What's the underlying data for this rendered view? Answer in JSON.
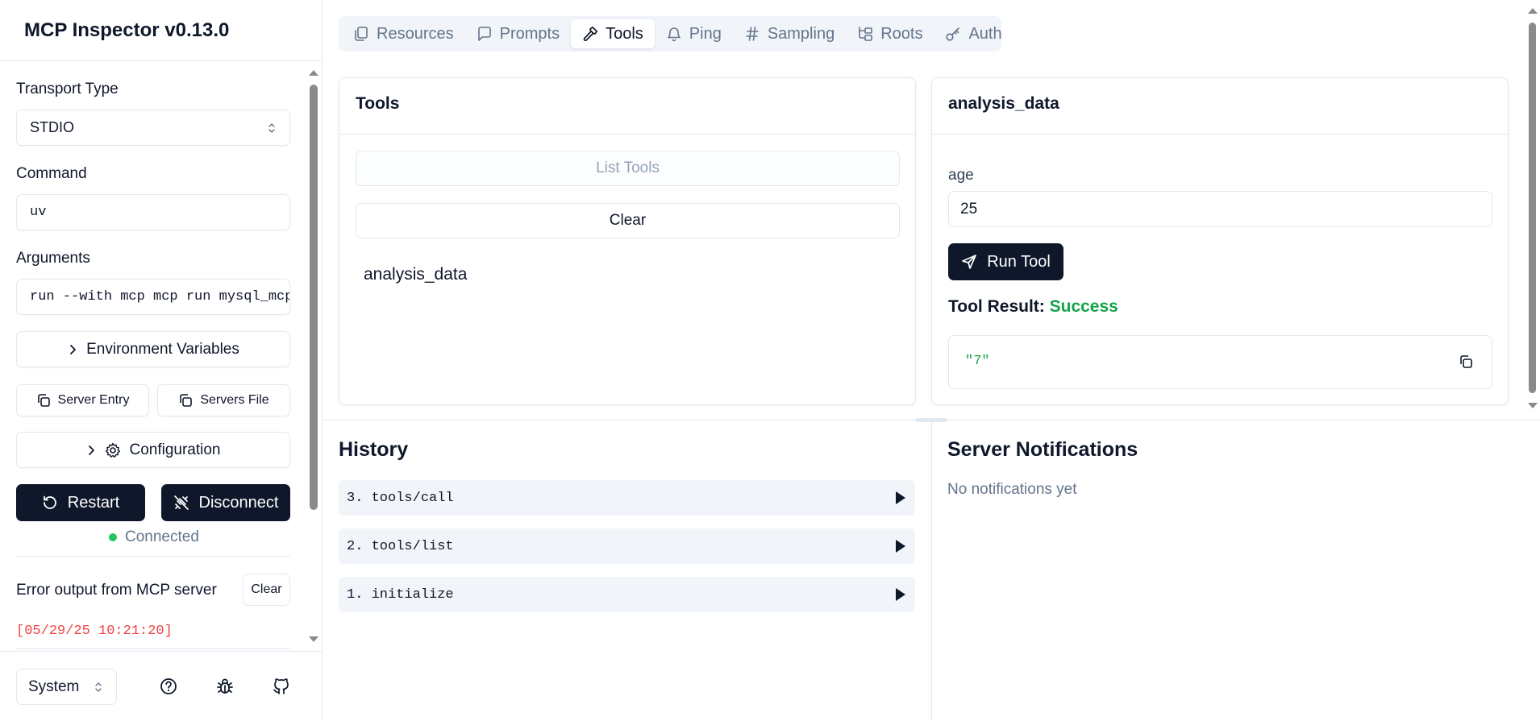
{
  "app": {
    "title": "MCP Inspector v0.13.0"
  },
  "sidebar": {
    "transport_label": "Transport Type",
    "transport_value": "STDIO",
    "command_label": "Command",
    "command_value": "uv",
    "arguments_label": "Arguments",
    "arguments_value": "run --with mcp mcp run mysql_mcp",
    "env_vars_label": "Environment Variables",
    "server_entry_label": "Server Entry",
    "servers_file_label": "Servers File",
    "configuration_label": "Configuration",
    "restart_label": "Restart",
    "disconnect_label": "Disconnect",
    "status_text": "Connected",
    "status_color": "#22c55e",
    "error_label": "Error output from MCP server",
    "error_clear_label": "Clear",
    "error_lines": [
      "[05/29/25 10:21:20]"
    ],
    "theme_value": "System"
  },
  "tabs": [
    {
      "label": "Resources",
      "icon": "files-icon"
    },
    {
      "label": "Prompts",
      "icon": "message-square-icon"
    },
    {
      "label": "Tools",
      "icon": "hammer-icon",
      "active": true
    },
    {
      "label": "Ping",
      "icon": "bell-icon"
    },
    {
      "label": "Sampling",
      "icon": "hash-icon"
    },
    {
      "label": "Roots",
      "icon": "folder-tree-icon"
    },
    {
      "label": "Auth",
      "icon": "key-icon"
    }
  ],
  "tools_panel": {
    "title": "Tools",
    "list_tools_label": "List Tools",
    "clear_label": "Clear",
    "items": [
      "analysis_data"
    ]
  },
  "tool_detail": {
    "title": "analysis_data",
    "param_label": "age",
    "param_value": "25",
    "run_label": "Run Tool",
    "result_label": "Tool Result:",
    "result_status": "Success",
    "result_status_color": "#16a34a",
    "result_value": "\"7\""
  },
  "history": {
    "title": "History",
    "items": [
      "3. tools/call",
      "2. tools/list",
      "1. initialize"
    ]
  },
  "notifications": {
    "title": "Server Notifications",
    "empty_text": "No notifications yet"
  }
}
